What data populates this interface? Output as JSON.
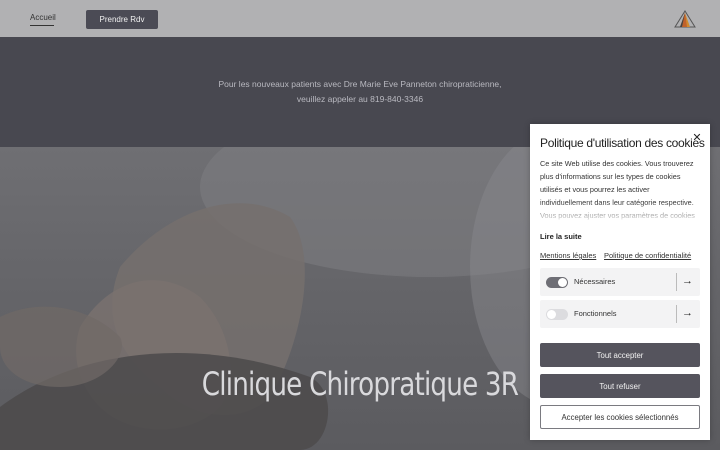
{
  "header": {
    "nav_home": "Accueil",
    "book_button": "Prendre Rdv",
    "logo_icon": "triangle-logo-icon"
  },
  "banner": {
    "line1": "Pour les nouveaux patients avec Dre Marie Eve Panneton chiropraticienne,",
    "line2": "veuillez appeler au 819-840-3346"
  },
  "hero": {
    "title": "Clinique Chiropratique 3R"
  },
  "cookie_panel": {
    "title": "Politique d'utilisation des cookies",
    "close_icon": "close-icon",
    "body": "Ce site Web utilise des cookies. Vous trouverez plus d'informations sur les types de cookies utilisés et vous pourrez les activer individuellement dans leur catégorie respective. Vous pouvez ajuster vos paramètres de cookies",
    "read_more": "Lire la suite",
    "links": {
      "legal": "Mentions légales",
      "privacy": "Politique de confidentialité"
    },
    "categories": [
      {
        "label": "Nécessaires",
        "enabled": true,
        "icon": "arrow-right-icon"
      },
      {
        "label": "Fonctionnels",
        "enabled": false,
        "icon": "arrow-right-icon"
      }
    ],
    "buttons": {
      "accept_all": "Tout accepter",
      "refuse_all": "Tout refuser",
      "accept_selected": "Accepter les cookies sélectionnés"
    }
  },
  "colors": {
    "header_bg": "#b1b1b3",
    "banner_bg": "#484850",
    "button_dark": "#55545d",
    "panel_bg": "#ffffff"
  }
}
